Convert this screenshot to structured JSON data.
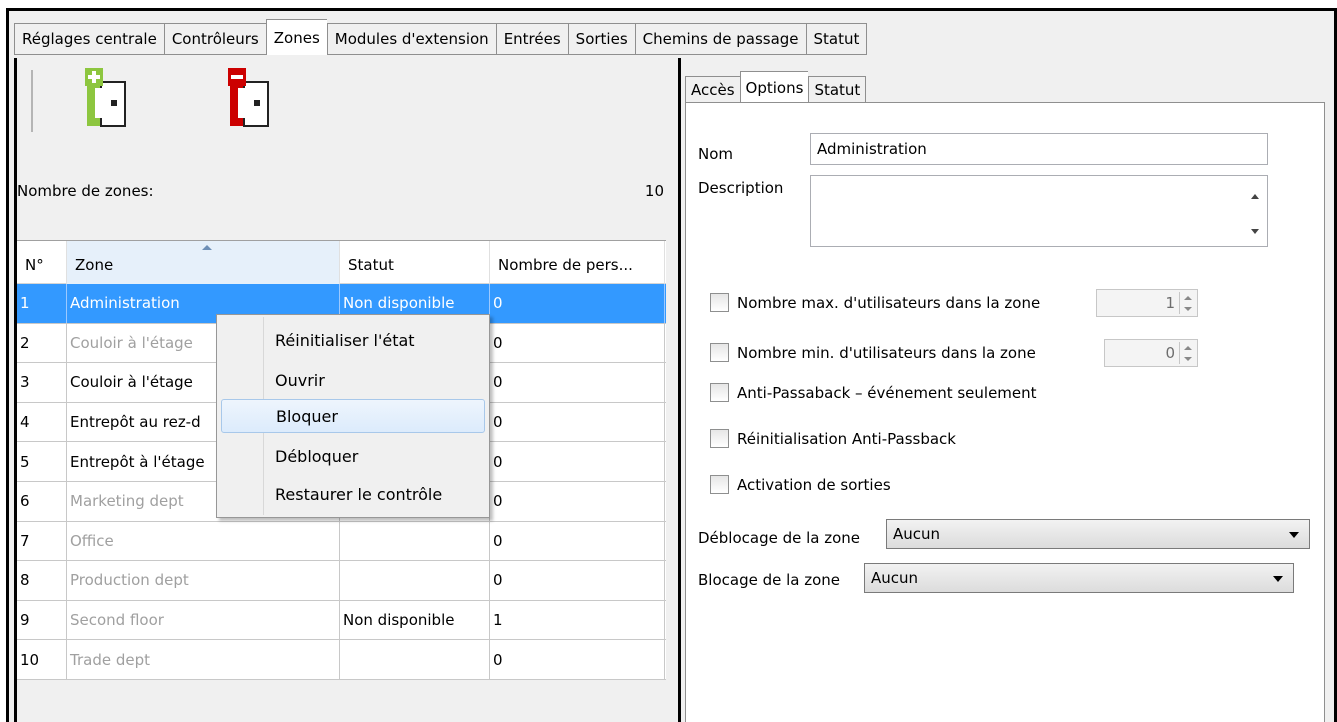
{
  "top_tabs": [
    "Réglages centrale",
    "Contrôleurs",
    "Zones",
    "Modules d'extension",
    "Entrées",
    "Sorties",
    "Chemins de passage",
    "Statut"
  ],
  "toolbar": {
    "add_icon": "add-zone-icon",
    "remove_icon": "remove-zone-icon",
    "add_color": "#8dc63f",
    "remove_color": "#cc0000"
  },
  "zone_count": {
    "label": "Nombre de zones:",
    "value": "10"
  },
  "grid": {
    "columns": [
      "N°",
      "Zone",
      "Statut",
      "Nombre de pers..."
    ],
    "rows": [
      {
        "n": "1",
        "zone": "Administration",
        "status": "Non disponible",
        "persons": "0"
      },
      {
        "n": "2",
        "zone": "Couloir à l'étage",
        "status": "",
        "persons": "0"
      },
      {
        "n": "3",
        "zone": "Couloir à l'étage",
        "status": "",
        "persons": "0"
      },
      {
        "n": "4",
        "zone": "Entrepôt au rez-d",
        "status": "",
        "persons": "0"
      },
      {
        "n": "5",
        "zone": "Entrepôt à l'étage",
        "status": "",
        "persons": "0"
      },
      {
        "n": "6",
        "zone": "Marketing dept",
        "status": "",
        "persons": "0"
      },
      {
        "n": "7",
        "zone": "Office",
        "status": "",
        "persons": "0"
      },
      {
        "n": "8",
        "zone": "Production dept",
        "status": "",
        "persons": "0"
      },
      {
        "n": "9",
        "zone": "Second floor",
        "status": "Non disponible",
        "persons": "1"
      },
      {
        "n": "10",
        "zone": "Trade dept",
        "status": "",
        "persons": "0"
      }
    ]
  },
  "context_menu": [
    "Réinitialiser l'état",
    "Ouvrir",
    "Bloquer",
    "Débloquer",
    "Restaurer le contrôle"
  ],
  "sub_tabs": [
    "Accès",
    "Options",
    "Statut"
  ],
  "options": {
    "name_label": "Nom",
    "name_value": "Administration",
    "description_label": "Description",
    "max_users_label": "Nombre max. d'utilisateurs dans la zone",
    "max_users_value": "1",
    "min_users_label": "Nombre min. d'utilisateurs dans la zone",
    "min_users_value": "0",
    "antipassback_label": "Anti-Passaback – événement seulement",
    "reset_antipassback_label": "Réinitialisation Anti-Passback",
    "outputs_label": "Activation de sorties",
    "unlock_label": "Déblocage de la zone",
    "unlock_value": "Aucun",
    "lock_label": "Blocage de la zone",
    "lock_value": "Aucun"
  },
  "colors": {
    "selection": "#3399ff",
    "dimmed_text": "#a0a0a0"
  }
}
